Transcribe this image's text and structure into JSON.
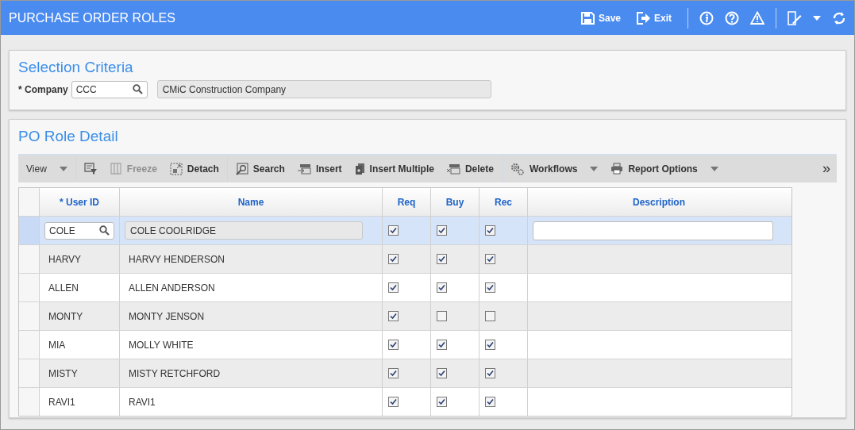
{
  "header": {
    "title": "PURCHASE ORDER ROLES",
    "actions": [
      {
        "label": "Save",
        "kind": "save"
      },
      {
        "label": "Exit",
        "kind": "exit"
      }
    ]
  },
  "selection": {
    "title": "Selection Criteria",
    "company_label": "* Company",
    "company_code": "CCC",
    "company_name": "CMiC Construction Company"
  },
  "detail": {
    "title": "PO Role Detail",
    "toolbar": [
      {
        "label": "View",
        "kind": "plain",
        "disabled": false,
        "menu": true
      },
      {
        "kind": "filter",
        "disabled": false,
        "menu": false
      },
      {
        "label": "Freeze",
        "kind": "freeze",
        "disabled": true,
        "menu": false
      },
      {
        "label": "Detach",
        "kind": "detach",
        "disabled": false,
        "menu": false
      },
      {
        "label": "Search",
        "kind": "search",
        "disabled": false,
        "menu": false
      },
      {
        "label": "Insert",
        "kind": "insert",
        "disabled": false,
        "menu": false
      },
      {
        "label": "Insert Multiple",
        "kind": "multi",
        "disabled": false,
        "menu": false
      },
      {
        "label": "Delete",
        "kind": "delete",
        "disabled": false,
        "menu": false
      },
      {
        "label": "Workflows",
        "kind": "gear",
        "disabled": false,
        "menu": true
      },
      {
        "label": "Report Options",
        "kind": "print",
        "disabled": false,
        "menu": true
      }
    ],
    "overflow": "»",
    "columns": [
      "* User ID",
      "Name",
      "Req",
      "Buy",
      "Rec",
      "Description"
    ],
    "rows": [
      {
        "selected": true,
        "user_id": "COLE",
        "name": "COLE COOLRIDGE",
        "req": true,
        "buy": true,
        "rec": true
      },
      {
        "selected": false,
        "user_id": "HARVY",
        "name": "HARVY HENDERSON",
        "req": true,
        "buy": true,
        "rec": true
      },
      {
        "selected": false,
        "user_id": "ALLEN",
        "name": "ALLEN ANDERSON",
        "req": true,
        "buy": true,
        "rec": true
      },
      {
        "selected": false,
        "user_id": "MONTY",
        "name": "MONTY JENSON",
        "req": true,
        "buy": false,
        "rec": false
      },
      {
        "selected": false,
        "user_id": "MIA",
        "name": "MOLLY WHITE",
        "req": true,
        "buy": true,
        "rec": true
      },
      {
        "selected": false,
        "user_id": "MISTY",
        "name": "MISTY RETCHFORD",
        "req": true,
        "buy": true,
        "rec": true
      },
      {
        "selected": false,
        "user_id": "RAVI1",
        "name": "RAVI1",
        "req": true,
        "buy": true,
        "rec": true
      }
    ]
  }
}
